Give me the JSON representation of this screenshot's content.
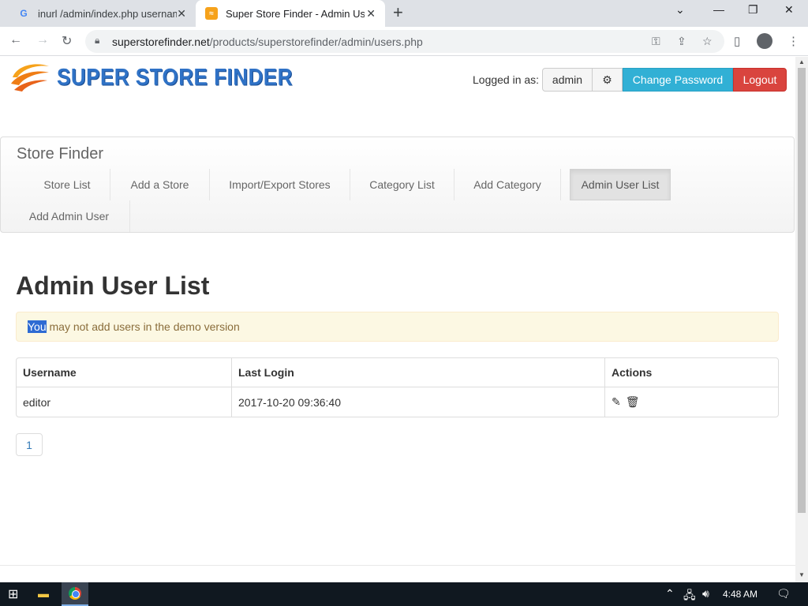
{
  "browser": {
    "tabs": [
      {
        "title": "inurl /admin/index.php username",
        "favicon": "google-icon",
        "active": false
      },
      {
        "title": "Super Store Finder - Admin User",
        "favicon": "ssf-icon",
        "active": true
      }
    ],
    "url_domain": "superstorefinder.net",
    "url_path": "/products/superstorefinder/admin/users.php"
  },
  "header": {
    "logo_text": "SUPER STORE FINDER",
    "logged_in_label": "Logged in as:",
    "username": "admin",
    "change_password_label": "Change Password",
    "logout_label": "Logout"
  },
  "nav": {
    "brand": "Store Finder",
    "items": [
      {
        "label": "Store List"
      },
      {
        "label": "Add a Store"
      },
      {
        "label": "Import/Export Stores"
      },
      {
        "label": "Category List"
      },
      {
        "label": "Add Category"
      },
      {
        "label": "Admin User List"
      },
      {
        "label": "Add Admin User"
      }
    ],
    "active_item": "Admin User List"
  },
  "main": {
    "title": "Admin User List",
    "alert_highlight": "You",
    "alert_rest": " may not add users in the demo version",
    "table": {
      "headers": [
        "Username",
        "Last Login",
        "Actions"
      ],
      "rows": [
        {
          "username": "editor",
          "last_login": "2017-10-20 09:36:40"
        }
      ]
    },
    "pagination": [
      "1"
    ]
  },
  "taskbar": {
    "time": "4:48 AM"
  },
  "colors": {
    "logo_blue": "#2f72c6",
    "info_button": "#31b0d5",
    "danger_button": "#d9443e",
    "alert_bg": "#fcf8e3",
    "alert_text": "#8a6d3b"
  }
}
